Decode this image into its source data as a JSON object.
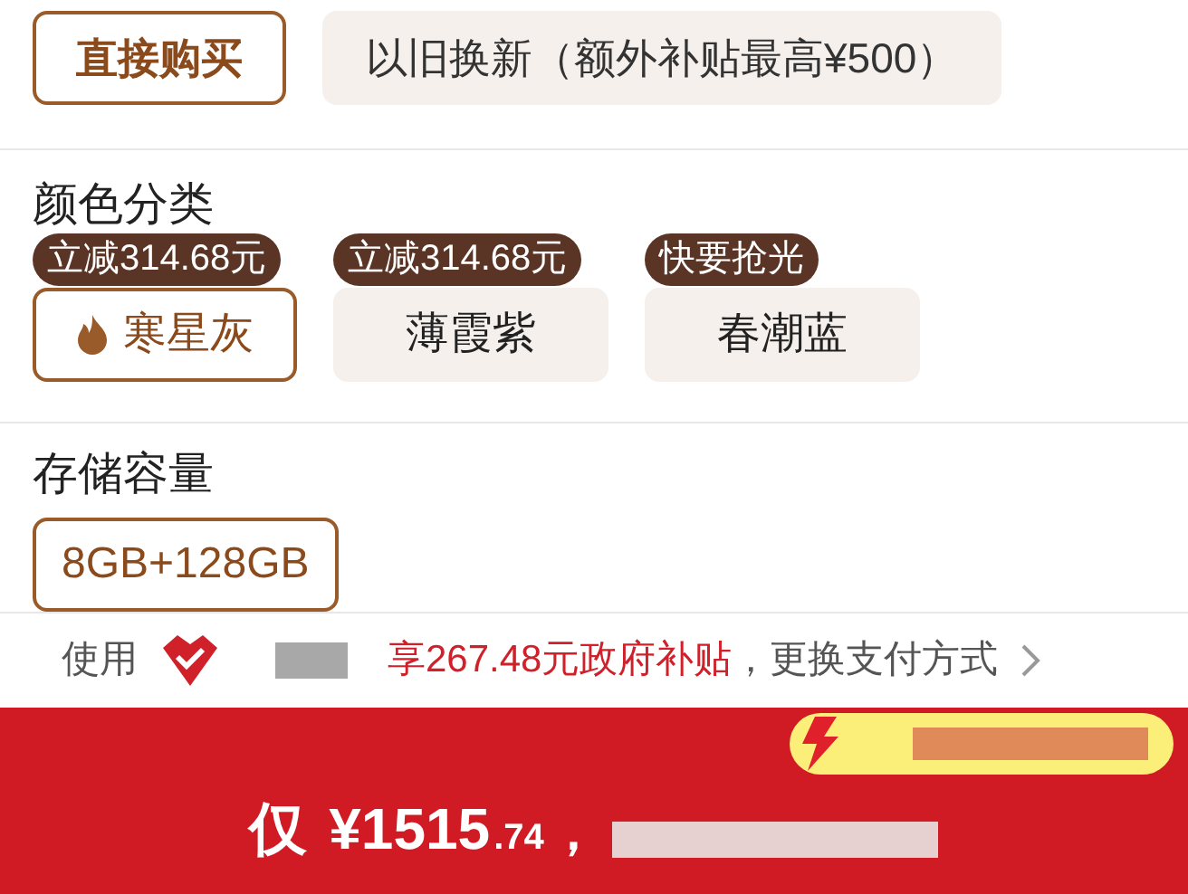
{
  "purchase_options": [
    {
      "label": "直接购买",
      "selected": true
    },
    {
      "label": "以旧换新（额外补贴最高¥500）",
      "selected": false
    }
  ],
  "color_section": {
    "title": "颜色分类",
    "options": [
      {
        "label": "寒星灰",
        "badge": "立减314.68元",
        "selected": true,
        "hot": true
      },
      {
        "label": "薄霞紫",
        "badge": "立减314.68元",
        "selected": false,
        "hot": false
      },
      {
        "label": "春潮蓝",
        "badge": "快要抢光",
        "selected": false,
        "hot": false
      }
    ]
  },
  "storage_section": {
    "title": "存储容量",
    "options": [
      {
        "label": "8GB+128GB",
        "selected": true
      }
    ]
  },
  "payment": {
    "prefix": "使用",
    "subsidy": "享267.48元政府补贴",
    "suffix": "，更换支付方式"
  },
  "buy_bar": {
    "prefix": "仅",
    "currency": "¥",
    "price_integer": "1515",
    "price_decimal": ".74",
    "suffix": "，"
  }
}
